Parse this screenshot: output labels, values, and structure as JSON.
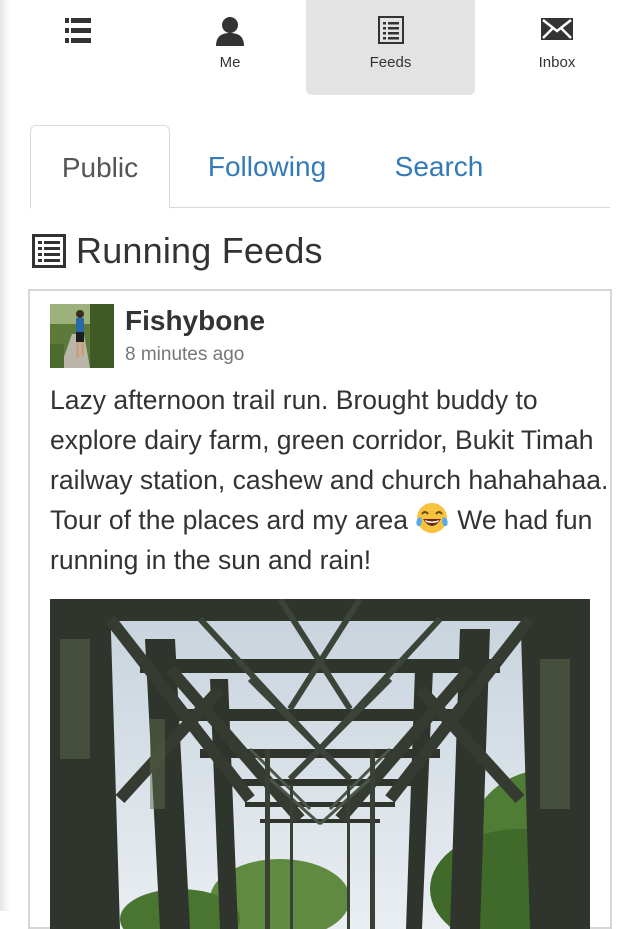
{
  "nav": {
    "menu_icon": "hamburger-icon",
    "items": [
      {
        "label": "Me",
        "icon": "user-icon"
      },
      {
        "label": "Feeds",
        "icon": "list-icon",
        "active": true
      },
      {
        "label": "Inbox",
        "icon": "envelope-icon"
      }
    ]
  },
  "tabs": [
    {
      "label": "Public",
      "active": true
    },
    {
      "label": "Following"
    },
    {
      "label": "Search"
    }
  ],
  "section": {
    "title": "Running Feeds",
    "icon": "list-icon"
  },
  "post": {
    "author": "Fishybone",
    "time": "8 minutes ago",
    "text": "Lazy afternoon trail run. Brought buddy to explore dairy farm, green corridor, Bukit Timah railway station, cashew and church hahahahaa. Tour of the places ard my area",
    "emoji": "tears-of-joy-emoji",
    "text_after_emoji": "We had fun running in the sun and rain!"
  },
  "colors": {
    "link": "#337ab7",
    "active_nav_bg": "#e3e3e3",
    "border": "#d6d6d6"
  }
}
